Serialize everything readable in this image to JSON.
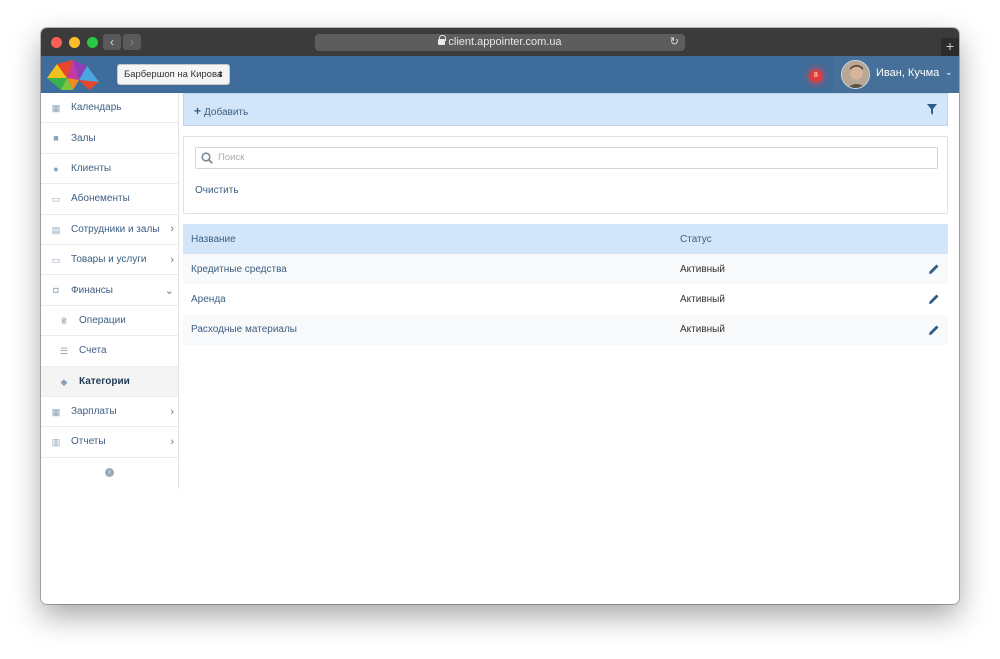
{
  "browser": {
    "url": "client.appointer.com.ua"
  },
  "header": {
    "branch_select": "Барбершоп на Кирова",
    "notification_count": "8",
    "user_name": "Иван, Кучма"
  },
  "sidebar": {
    "items": [
      {
        "label": "Календарь",
        "icon": "calendar-icon"
      },
      {
        "label": "Залы",
        "icon": "bookmark-icon"
      },
      {
        "label": "Клиенты",
        "icon": "users-icon"
      },
      {
        "label": "Абонементы",
        "icon": "card-icon"
      },
      {
        "label": "Сотрудники и залы",
        "icon": "id-card-icon",
        "chevron": "right"
      },
      {
        "label": "Товары и услуги",
        "icon": "card-icon",
        "chevron": "right"
      },
      {
        "label": "Финансы",
        "icon": "money-icon",
        "chevron": "down"
      },
      {
        "label": "Операции",
        "icon": "hryvnia-icon",
        "sub": true
      },
      {
        "label": "Счета",
        "icon": "list-icon",
        "sub": true
      },
      {
        "label": "Категории",
        "icon": "tags-icon",
        "sub": true,
        "active": true
      },
      {
        "label": "Зарплаты",
        "icon": "calculator-icon",
        "chevron": "right"
      },
      {
        "label": "Отчеты",
        "icon": "bar-chart-icon",
        "chevron": "right"
      }
    ]
  },
  "toolbar": {
    "add_label": "Добавить"
  },
  "search": {
    "placeholder": "Поиск",
    "clear_label": "Очистить"
  },
  "table": {
    "columns": [
      "Название",
      "Статус"
    ],
    "rows": [
      {
        "name": "Кредитные средства",
        "status": "Активный"
      },
      {
        "name": "Аренда",
        "status": "Активный"
      },
      {
        "name": "Расходные материалы",
        "status": "Активный"
      }
    ]
  },
  "colors": {
    "header_bg": "#3e6d9c",
    "toolbar_bg": "#d3e6f9",
    "link": "#3d5f82"
  }
}
